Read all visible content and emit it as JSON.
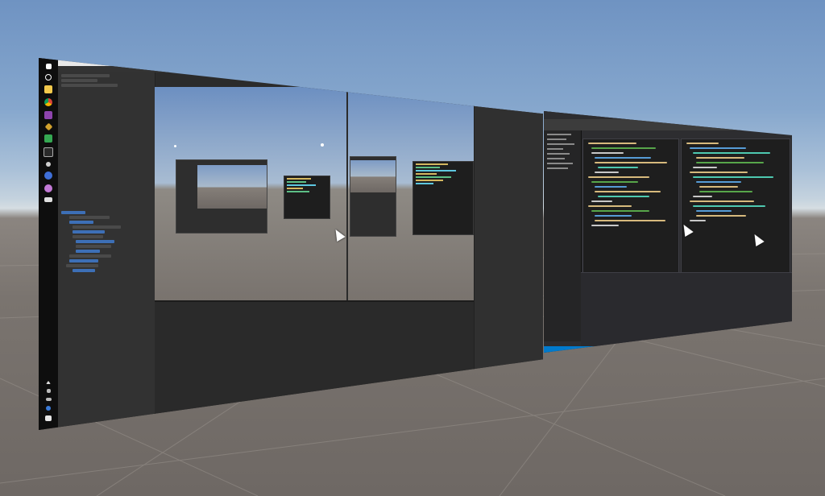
{
  "scene": {
    "sky_color": "#7fa0c8",
    "ground_color": "#7a746f",
    "accent_blue": "#007acc"
  },
  "left_monitor": {
    "taskbar_icons": [
      "windows-icon",
      "search-icon",
      "folder-icon",
      "chrome-icon",
      "visual-studio-icon",
      "unity-icon",
      "vs-code-icon",
      "terminal-icon",
      "gear-icon",
      "app-icon",
      "camera-icon",
      "monitor-icon"
    ],
    "tray_icons": [
      "chevron-up-icon",
      "speaker-icon",
      "network-icon",
      "user-icon",
      "notifications-icon"
    ]
  },
  "right_monitor": {
    "editors": 2
  },
  "cursors": 3
}
